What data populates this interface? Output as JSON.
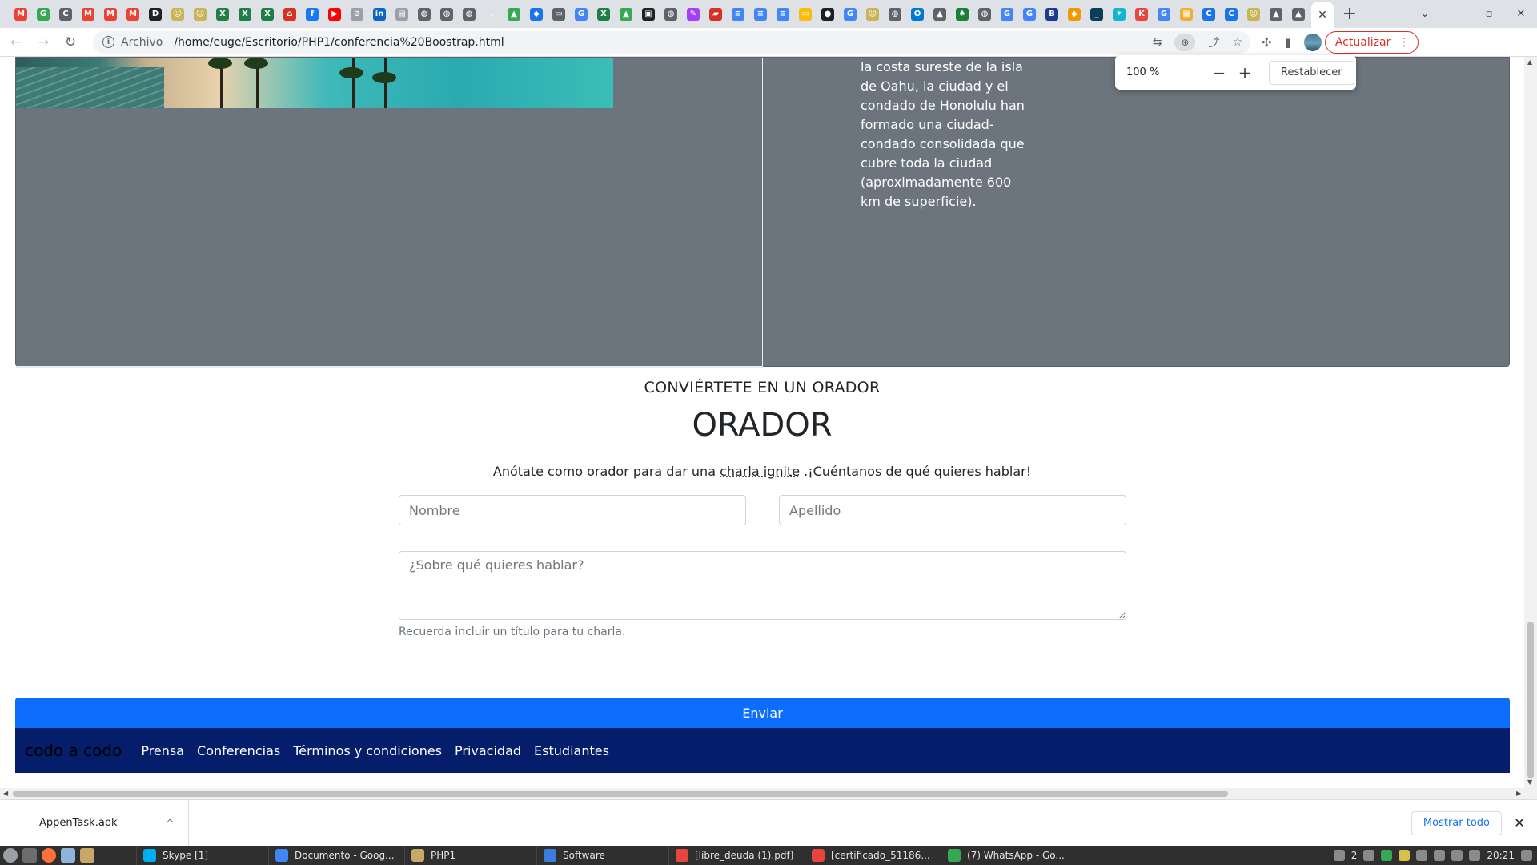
{
  "browser": {
    "tab_icons": [
      {
        "name": "gmail",
        "color": "#ea4335",
        "glyph": "M"
      },
      {
        "name": "chrome-circle",
        "color": "#34a853",
        "glyph": "G"
      },
      {
        "name": "calc",
        "color": "#5f6368",
        "glyph": "C"
      },
      {
        "name": "gmail",
        "color": "#ea4335",
        "glyph": "M"
      },
      {
        "name": "gmail",
        "color": "#ea4335",
        "glyph": "M"
      },
      {
        "name": "gmail",
        "color": "#ea4335",
        "glyph": "M"
      },
      {
        "name": "doc-dark",
        "color": "#202124",
        "glyph": "D"
      },
      {
        "name": "smiley",
        "color": "#c9b458",
        "glyph": "☺"
      },
      {
        "name": "smiley",
        "color": "#c9b458",
        "glyph": "☺"
      },
      {
        "name": "excel",
        "color": "#1e7e45",
        "glyph": "X"
      },
      {
        "name": "excel",
        "color": "#1e7e45",
        "glyph": "X"
      },
      {
        "name": "excel",
        "color": "#1e7e45",
        "glyph": "X"
      },
      {
        "name": "home",
        "color": "#d93025",
        "glyph": "⌂"
      },
      {
        "name": "facebook",
        "color": "#1877f2",
        "glyph": "f"
      },
      {
        "name": "youtube",
        "color": "#ff0000",
        "glyph": "▶"
      },
      {
        "name": "link",
        "color": "#9aa0a6",
        "glyph": "⊘"
      },
      {
        "name": "linkedin",
        "color": "#0a66c2",
        "glyph": "in"
      },
      {
        "name": "page",
        "color": "#9aa0a6",
        "glyph": "▤"
      },
      {
        "name": "globe",
        "color": "#5f6368",
        "glyph": "◍"
      },
      {
        "name": "globe",
        "color": "#5f6368",
        "glyph": "◍"
      },
      {
        "name": "globe",
        "color": "#5f6368",
        "glyph": "◍"
      },
      {
        "name": "dot",
        "color": "#dee1e6",
        "glyph": "."
      },
      {
        "name": "drive",
        "color": "#34a853",
        "glyph": "▲"
      },
      {
        "name": "cloud",
        "color": "#1a73e8",
        "glyph": "◆"
      },
      {
        "name": "bar",
        "color": "#5f6368",
        "glyph": "▭"
      },
      {
        "name": "google",
        "color": "#4285f4",
        "glyph": "G"
      },
      {
        "name": "excel",
        "color": "#1e7e45",
        "glyph": "X"
      },
      {
        "name": "drive",
        "color": "#34a853",
        "glyph": "▲"
      },
      {
        "name": "window",
        "color": "#202124",
        "glyph": "▣"
      },
      {
        "name": "globe",
        "color": "#5f6368",
        "glyph": "◍"
      },
      {
        "name": "pen",
        "color": "#a142f4",
        "glyph": "✎"
      },
      {
        "name": "slides",
        "color": "#d93025",
        "glyph": "▰"
      },
      {
        "name": "docs",
        "color": "#4285f4",
        "glyph": "≡"
      },
      {
        "name": "docs",
        "color": "#4285f4",
        "glyph": "≡"
      },
      {
        "name": "docs",
        "color": "#4285f4",
        "glyph": "≡"
      },
      {
        "name": "note",
        "color": "#fbbc04",
        "glyph": "▭"
      },
      {
        "name": "github",
        "color": "#202124",
        "glyph": "●"
      },
      {
        "name": "google",
        "color": "#4285f4",
        "glyph": "G"
      },
      {
        "name": "smiley",
        "color": "#c9b458",
        "glyph": "☺"
      },
      {
        "name": "globe",
        "color": "#5f6368",
        "glyph": "◍"
      },
      {
        "name": "outlook",
        "color": "#0078d4",
        "glyph": "O"
      },
      {
        "name": "mountain",
        "color": "#5f6368",
        "glyph": "▲"
      },
      {
        "name": "leaf",
        "color": "#188038",
        "glyph": "♠"
      },
      {
        "name": "globe",
        "color": "#5f6368",
        "glyph": "◍"
      },
      {
        "name": "google",
        "color": "#4285f4",
        "glyph": "G"
      },
      {
        "name": "google",
        "color": "#4285f4",
        "glyph": "G"
      },
      {
        "name": "bold-b",
        "color": "#1a3e8c",
        "glyph": "B"
      },
      {
        "name": "diamond",
        "color": "#f29900",
        "glyph": "◆"
      },
      {
        "name": "terminal",
        "color": "#0b3d5b",
        "glyph": "_"
      },
      {
        "name": "star",
        "color": "#12b5cb",
        "glyph": "✶"
      },
      {
        "name": "k-app",
        "color": "#e8453c",
        "glyph": "K"
      },
      {
        "name": "google",
        "color": "#4285f4",
        "glyph": "G"
      },
      {
        "name": "archive",
        "color": "#f6ad2f",
        "glyph": "▦"
      },
      {
        "name": "c-app",
        "color": "#1a73e8",
        "glyph": "C"
      },
      {
        "name": "c-app",
        "color": "#1a73e8",
        "glyph": "C"
      },
      {
        "name": "smiley",
        "color": "#c9b458",
        "glyph": "☺"
      },
      {
        "name": "mountain",
        "color": "#5f6368",
        "glyph": "▲"
      },
      {
        "name": "mountain",
        "color": "#5f6368",
        "glyph": "▲"
      },
      {
        "name": "globe",
        "color": "#5f6368",
        "glyph": "◍"
      }
    ],
    "active_tab_close": "✕",
    "new_tab": "+",
    "window_controls": [
      "⌄",
      "–",
      "▫",
      "✕"
    ],
    "omnibox": {
      "scheme": "Archivo",
      "url": "/home/euge/Escritorio/PHP1/conferencia%20Boostrap.html"
    },
    "update_button": "Actualizar",
    "zoom_popup": {
      "percent": "100 %",
      "minus": "−",
      "plus": "+",
      "reset": "Restablecer"
    }
  },
  "page": {
    "beach_description": "la costa sureste de la isla de Oahu, la ciudad y el condado de Honolulu han formado una ciudad-condado consolidada que cubre toda la ciudad (aproximadamente 600 km de superficie).",
    "speaker_section": {
      "kicker": "CONVIÉRTETE EN UN ORADOR",
      "heading": "ORADOR",
      "lead_before": "Anótate como orador para dar una",
      "lead_abbr": "charla ignite",
      "lead_after": ".¡Cuéntanos de qué quieres hablar!",
      "name_placeholder": "Nombre",
      "surname_placeholder": "Apellido",
      "topic_placeholder": "¿Sobre qué quieres hablar?",
      "helper_text": "Recuerda incluir un título para tu charla.",
      "submit_label": "Enviar"
    },
    "footer": {
      "brand": "codo a codo",
      "links": [
        "Prensa",
        "Conferencias",
        "Términos y condiciones",
        "Privacidad",
        "Estudiantes"
      ]
    }
  },
  "downloads": {
    "file": "AppenTask.apk",
    "show_all": "Mostrar todo",
    "close": "✕"
  },
  "taskbar": {
    "tasks": [
      {
        "label": "Skype [1]",
        "color": "#00aff0"
      },
      {
        "label": "Documento - Goog...",
        "color": "#4285f4"
      },
      {
        "label": "PHP1",
        "color": "#c8a866"
      },
      {
        "label": "Software",
        "color": "#3b7ddd"
      },
      {
        "label": "[libre_deuda (1).pdf]",
        "color": "#e8453c"
      },
      {
        "label": "[certificado_51186...",
        "color": "#e8453c"
      },
      {
        "label": "(7) WhatsApp - Go...",
        "color": "#34a853"
      }
    ],
    "tray_count": "2",
    "clock": "20:21"
  }
}
